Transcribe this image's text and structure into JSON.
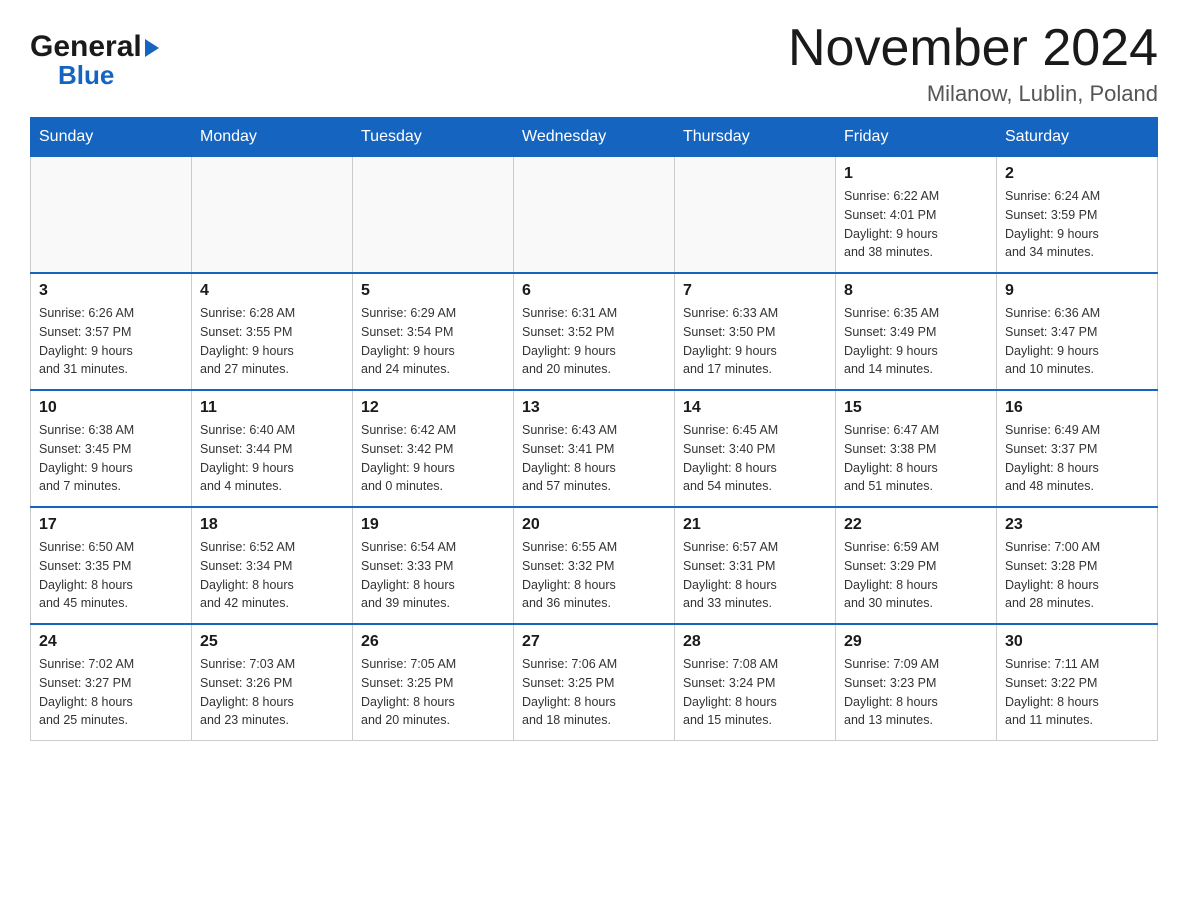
{
  "header": {
    "logo_general": "General",
    "logo_triangle": "▶",
    "logo_blue": "Blue",
    "month_title": "November 2024",
    "location": "Milanow, Lublin, Poland"
  },
  "weekdays": [
    "Sunday",
    "Monday",
    "Tuesday",
    "Wednesday",
    "Thursday",
    "Friday",
    "Saturday"
  ],
  "weeks": [
    [
      {
        "day": "",
        "info": ""
      },
      {
        "day": "",
        "info": ""
      },
      {
        "day": "",
        "info": ""
      },
      {
        "day": "",
        "info": ""
      },
      {
        "day": "",
        "info": ""
      },
      {
        "day": "1",
        "info": "Sunrise: 6:22 AM\nSunset: 4:01 PM\nDaylight: 9 hours\nand 38 minutes."
      },
      {
        "day": "2",
        "info": "Sunrise: 6:24 AM\nSunset: 3:59 PM\nDaylight: 9 hours\nand 34 minutes."
      }
    ],
    [
      {
        "day": "3",
        "info": "Sunrise: 6:26 AM\nSunset: 3:57 PM\nDaylight: 9 hours\nand 31 minutes."
      },
      {
        "day": "4",
        "info": "Sunrise: 6:28 AM\nSunset: 3:55 PM\nDaylight: 9 hours\nand 27 minutes."
      },
      {
        "day": "5",
        "info": "Sunrise: 6:29 AM\nSunset: 3:54 PM\nDaylight: 9 hours\nand 24 minutes."
      },
      {
        "day": "6",
        "info": "Sunrise: 6:31 AM\nSunset: 3:52 PM\nDaylight: 9 hours\nand 20 minutes."
      },
      {
        "day": "7",
        "info": "Sunrise: 6:33 AM\nSunset: 3:50 PM\nDaylight: 9 hours\nand 17 minutes."
      },
      {
        "day": "8",
        "info": "Sunrise: 6:35 AM\nSunset: 3:49 PM\nDaylight: 9 hours\nand 14 minutes."
      },
      {
        "day": "9",
        "info": "Sunrise: 6:36 AM\nSunset: 3:47 PM\nDaylight: 9 hours\nand 10 minutes."
      }
    ],
    [
      {
        "day": "10",
        "info": "Sunrise: 6:38 AM\nSunset: 3:45 PM\nDaylight: 9 hours\nand 7 minutes."
      },
      {
        "day": "11",
        "info": "Sunrise: 6:40 AM\nSunset: 3:44 PM\nDaylight: 9 hours\nand 4 minutes."
      },
      {
        "day": "12",
        "info": "Sunrise: 6:42 AM\nSunset: 3:42 PM\nDaylight: 9 hours\nand 0 minutes."
      },
      {
        "day": "13",
        "info": "Sunrise: 6:43 AM\nSunset: 3:41 PM\nDaylight: 8 hours\nand 57 minutes."
      },
      {
        "day": "14",
        "info": "Sunrise: 6:45 AM\nSunset: 3:40 PM\nDaylight: 8 hours\nand 54 minutes."
      },
      {
        "day": "15",
        "info": "Sunrise: 6:47 AM\nSunset: 3:38 PM\nDaylight: 8 hours\nand 51 minutes."
      },
      {
        "day": "16",
        "info": "Sunrise: 6:49 AM\nSunset: 3:37 PM\nDaylight: 8 hours\nand 48 minutes."
      }
    ],
    [
      {
        "day": "17",
        "info": "Sunrise: 6:50 AM\nSunset: 3:35 PM\nDaylight: 8 hours\nand 45 minutes."
      },
      {
        "day": "18",
        "info": "Sunrise: 6:52 AM\nSunset: 3:34 PM\nDaylight: 8 hours\nand 42 minutes."
      },
      {
        "day": "19",
        "info": "Sunrise: 6:54 AM\nSunset: 3:33 PM\nDaylight: 8 hours\nand 39 minutes."
      },
      {
        "day": "20",
        "info": "Sunrise: 6:55 AM\nSunset: 3:32 PM\nDaylight: 8 hours\nand 36 minutes."
      },
      {
        "day": "21",
        "info": "Sunrise: 6:57 AM\nSunset: 3:31 PM\nDaylight: 8 hours\nand 33 minutes."
      },
      {
        "day": "22",
        "info": "Sunrise: 6:59 AM\nSunset: 3:29 PM\nDaylight: 8 hours\nand 30 minutes."
      },
      {
        "day": "23",
        "info": "Sunrise: 7:00 AM\nSunset: 3:28 PM\nDaylight: 8 hours\nand 28 minutes."
      }
    ],
    [
      {
        "day": "24",
        "info": "Sunrise: 7:02 AM\nSunset: 3:27 PM\nDaylight: 8 hours\nand 25 minutes."
      },
      {
        "day": "25",
        "info": "Sunrise: 7:03 AM\nSunset: 3:26 PM\nDaylight: 8 hours\nand 23 minutes."
      },
      {
        "day": "26",
        "info": "Sunrise: 7:05 AM\nSunset: 3:25 PM\nDaylight: 8 hours\nand 20 minutes."
      },
      {
        "day": "27",
        "info": "Sunrise: 7:06 AM\nSunset: 3:25 PM\nDaylight: 8 hours\nand 18 minutes."
      },
      {
        "day": "28",
        "info": "Sunrise: 7:08 AM\nSunset: 3:24 PM\nDaylight: 8 hours\nand 15 minutes."
      },
      {
        "day": "29",
        "info": "Sunrise: 7:09 AM\nSunset: 3:23 PM\nDaylight: 8 hours\nand 13 minutes."
      },
      {
        "day": "30",
        "info": "Sunrise: 7:11 AM\nSunset: 3:22 PM\nDaylight: 8 hours\nand 11 minutes."
      }
    ]
  ]
}
